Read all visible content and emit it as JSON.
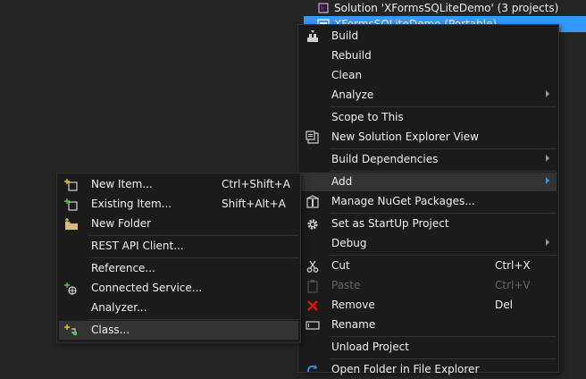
{
  "explorer": {
    "solution_label": "Solution 'XFormsSQLiteDemo' (3 projects)",
    "project_label": "XFormsSQLiteDemo (Portable)"
  },
  "context_menu": {
    "build": "Build",
    "rebuild": "Rebuild",
    "clean": "Clean",
    "analyze": "Analyze",
    "scope_to_this": "Scope to This",
    "new_solution_explorer_view": "New Solution Explorer View",
    "build_dependencies": "Build Dependencies",
    "add": "Add",
    "manage_nuget": "Manage NuGet Packages...",
    "set_startup": "Set as StartUp Project",
    "debug": "Debug",
    "cut": "Cut",
    "cut_shortcut": "Ctrl+X",
    "paste": "Paste",
    "paste_shortcut": "Ctrl+V",
    "remove": "Remove",
    "remove_shortcut": "Del",
    "rename": "Rename",
    "unload_project": "Unload Project",
    "open_folder": "Open Folder in File Explorer"
  },
  "add_submenu": {
    "new_item": "New Item...",
    "new_item_shortcut": "Ctrl+Shift+A",
    "existing_item": "Existing Item...",
    "existing_item_shortcut": "Shift+Alt+A",
    "new_folder": "New Folder",
    "rest_api_client": "REST API Client...",
    "reference": "Reference...",
    "connected_service": "Connected Service...",
    "analyzer": "Analyzer...",
    "class": "Class..."
  },
  "colors": {
    "background": "#252526",
    "menu_bg": "#1b1b1c",
    "highlight": "#333334",
    "selection": "#3399ff",
    "text": "#f1f1f1",
    "disabled": "#656565",
    "remove_red": "#e51400"
  }
}
